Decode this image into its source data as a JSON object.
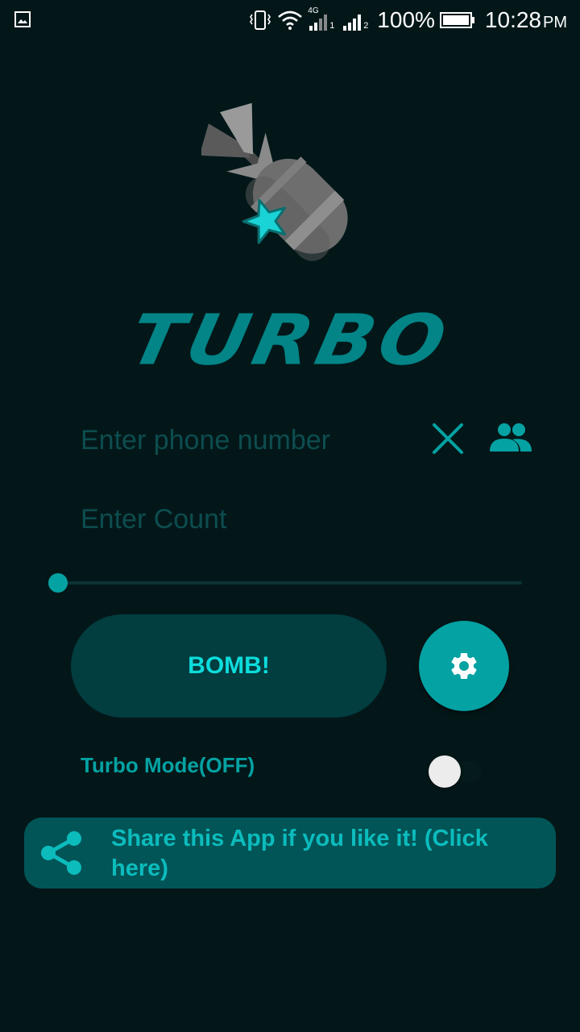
{
  "status_bar": {
    "battery_percent": "100%",
    "time": "10:28",
    "ampm": "PM",
    "network": "4G",
    "sim1": "1",
    "sim2": "2",
    "icons": [
      "gallery-notification-icon",
      "vibrate-icon",
      "wifi-icon",
      "signal-icon",
      "battery-icon"
    ]
  },
  "logo": {
    "title": "TURBO",
    "icon": "bomb-icon"
  },
  "form": {
    "phone_placeholder": "Enter phone number",
    "phone_value": "",
    "count_placeholder": "Enter Count",
    "count_value": "",
    "clear_icon": "close-icon",
    "contacts_icon": "contacts-icon"
  },
  "slider": {
    "value": 0
  },
  "actions": {
    "bomb_label": "BOMB!",
    "settings_icon": "gear-icon"
  },
  "turbo_mode": {
    "label": "Turbo Mode(OFF)",
    "enabled": false
  },
  "share": {
    "text": "Share this App if you like it! (Click here)",
    "icon": "share-icon"
  },
  "colors": {
    "background": "#031719",
    "accent": "#04a2a3",
    "title": "#038486",
    "button_dark": "#023d3f",
    "banner": "#025557"
  }
}
